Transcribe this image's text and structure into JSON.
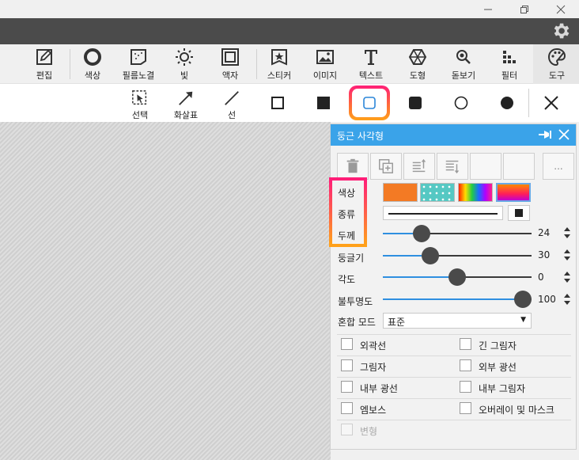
{
  "toolbar": {
    "tools": [
      {
        "label": "편집",
        "icon": "edit-icon"
      },
      {
        "label": "색상",
        "icon": "color-ring-icon"
      },
      {
        "label": "필름노결",
        "icon": "film-grain-icon"
      },
      {
        "label": "빛",
        "icon": "light-icon"
      },
      {
        "label": "액자",
        "icon": "frame-icon"
      },
      {
        "label": "스티커",
        "icon": "sticker-icon"
      },
      {
        "label": "이미지",
        "icon": "image-icon"
      },
      {
        "label": "텍스트",
        "icon": "text-icon"
      },
      {
        "label": "도형",
        "icon": "shape-icon"
      },
      {
        "label": "돋보기",
        "icon": "magnifier-icon"
      },
      {
        "label": "필터",
        "icon": "filter-icon"
      },
      {
        "label": "도구",
        "icon": "palette-icon"
      }
    ]
  },
  "subtoolbar": {
    "select_label": "선택",
    "arrow_label": "화살표",
    "line_label": "선"
  },
  "panel": {
    "title": "둥근 사각형",
    "color_label": "색상",
    "type_label": "종류",
    "thickness_label": "두께",
    "sliders": [
      {
        "label": "두께",
        "value": "24",
        "fraction": 0.26
      },
      {
        "label": "둥글기",
        "value": "30",
        "fraction": 0.32
      },
      {
        "label": "각도",
        "value": "0",
        "fraction": 0.5
      },
      {
        "label": "불투명도",
        "value": "100",
        "fraction": 1.0
      }
    ],
    "blend_label": "혼합 모드",
    "blend_value": "표준",
    "more_button": "...",
    "checkboxes": [
      {
        "label": "외곽선",
        "checked": false,
        "enabled": true
      },
      {
        "label": "긴 그림자",
        "checked": false,
        "enabled": true
      },
      {
        "label": "그림자",
        "checked": false,
        "enabled": true
      },
      {
        "label": "외부 광선",
        "checked": false,
        "enabled": true
      },
      {
        "label": "내부 광선",
        "checked": false,
        "enabled": true
      },
      {
        "label": "내부 그림자",
        "checked": false,
        "enabled": true
      },
      {
        "label": "엠보스",
        "checked": false,
        "enabled": true
      },
      {
        "label": "오버레이 및 마스크",
        "checked": false,
        "enabled": true
      },
      {
        "label": "변형",
        "checked": false,
        "enabled": false
      }
    ]
  },
  "colors": {
    "accent": "#3aa3e9",
    "fill_swatch": "#f37a24",
    "highlight_start": "#ff1e78",
    "highlight_end": "#ffa11a"
  }
}
